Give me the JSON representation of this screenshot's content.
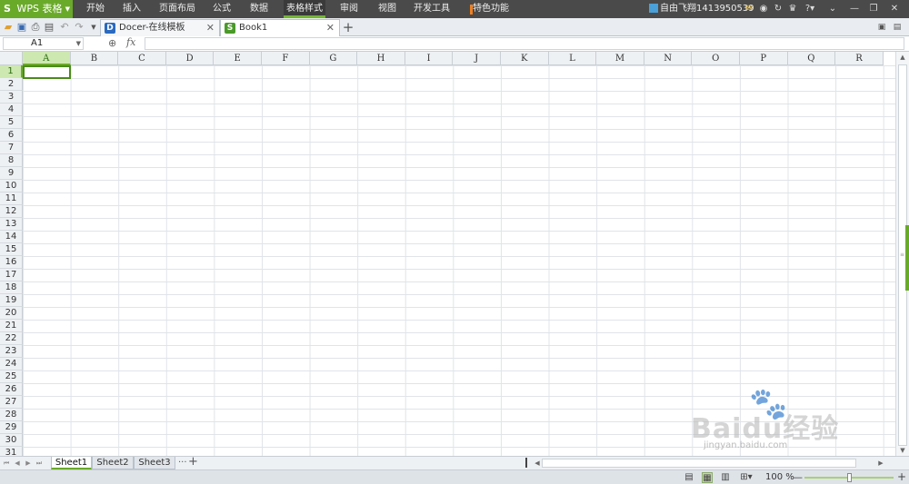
{
  "app": {
    "name": "WPS 表格",
    "logo": "S"
  },
  "menu": [
    "开始",
    "插入",
    "页面布局",
    "公式",
    "数据",
    "表格样式",
    "审阅",
    "视图",
    "开发工具",
    "特色功能"
  ],
  "active_menu_index": 5,
  "user": {
    "label": "自由飞翔1413950539"
  },
  "quick_toolbar": [
    "open-icon",
    "save-icon",
    "print-icon",
    "print-preview-icon",
    "undo-icon",
    "redo-icon",
    "customize-icon"
  ],
  "doc_tabs": [
    {
      "label": "Docer-在线模板",
      "icon": "D"
    },
    {
      "label": "Book1",
      "icon": "S"
    }
  ],
  "formula_bar": {
    "name_box": "A1",
    "fx": "fx",
    "formula": ""
  },
  "columns": [
    "A",
    "B",
    "C",
    "D",
    "E",
    "F",
    "G",
    "H",
    "I",
    "J",
    "K",
    "L",
    "M",
    "N",
    "O",
    "P",
    "Q",
    "R"
  ],
  "rows": [
    "1",
    "2",
    "3",
    "4",
    "5",
    "6",
    "7",
    "8",
    "9",
    "10",
    "11",
    "12",
    "13",
    "14",
    "15",
    "16",
    "17",
    "18",
    "19",
    "20",
    "21",
    "22",
    "23",
    "24",
    "25",
    "26",
    "27",
    "28",
    "29",
    "30",
    "31"
  ],
  "selected_cell": "A1",
  "sheets": [
    "Sheet1",
    "Sheet2",
    "Sheet3"
  ],
  "active_sheet": "Sheet1",
  "sheet_more": "···",
  "zoom": {
    "label": "100 %",
    "percent": 100
  },
  "watermark": {
    "brand": "Baidu经验",
    "url": "jingyan.baidu.com"
  },
  "colors": {
    "accent": "#6aaa2a",
    "menubar": "#4a4a4a",
    "orange_mark": "#f08020"
  }
}
